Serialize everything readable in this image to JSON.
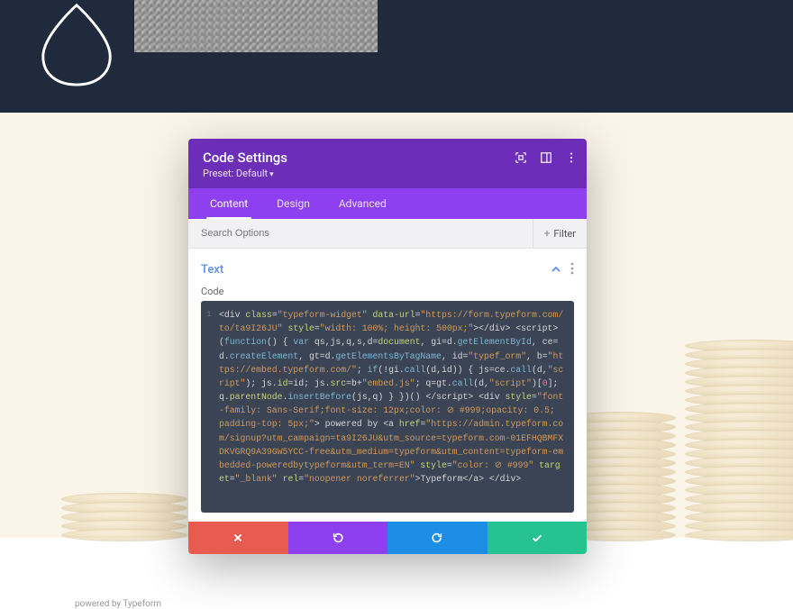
{
  "footer_powered": "powered by Typeform",
  "modal": {
    "title": "Code Settings",
    "preset_label": "Preset: Default",
    "tabs": [
      "Content",
      "Design",
      "Advanced"
    ],
    "active_tab": 0,
    "search_placeholder": "Search Options",
    "filter_label": "Filter",
    "section_title": "Text",
    "field_label": "Code",
    "code_tokens": [
      {
        "t": "tag",
        "v": "<div "
      },
      {
        "t": "attr",
        "v": "class"
      },
      {
        "t": "tag",
        "v": "="
      },
      {
        "t": "str",
        "v": "\"typeform-widget\""
      },
      {
        "t": "tag",
        "v": " "
      },
      {
        "t": "attr",
        "v": "data-url"
      },
      {
        "t": "tag",
        "v": "="
      },
      {
        "t": "str",
        "v": "\"https://form.typeform.com/to/ta9I26JU\""
      },
      {
        "t": "tag",
        "v": " "
      },
      {
        "t": "attr",
        "v": "style"
      },
      {
        "t": "tag",
        "v": "="
      },
      {
        "t": "str",
        "v": "\"width: 100%; height: 500px;\""
      },
      {
        "t": "tag",
        "v": "></div> <script> "
      },
      {
        "t": "key",
        "v": "("
      },
      {
        "t": "fn",
        "v": "function"
      },
      {
        "t": "key",
        "v": "() { "
      },
      {
        "t": "fn",
        "v": "var"
      },
      {
        "t": "key",
        "v": " qs,js,q,s,d="
      },
      {
        "t": "builtin",
        "v": "document"
      },
      {
        "t": "key",
        "v": ", gi=d."
      },
      {
        "t": "fn",
        "v": "getElementById"
      },
      {
        "t": "key",
        "v": ", ce=d."
      },
      {
        "t": "fn",
        "v": "createElement"
      },
      {
        "t": "key",
        "v": ", gt=d."
      },
      {
        "t": "fn",
        "v": "getElementsByTagName"
      },
      {
        "t": "key",
        "v": ", id="
      },
      {
        "t": "str",
        "v": "\"typef_orm\""
      },
      {
        "t": "key",
        "v": ", b="
      },
      {
        "t": "str",
        "v": "\"https://embed.typeform.com/\""
      },
      {
        "t": "key",
        "v": "; "
      },
      {
        "t": "fn",
        "v": "if"
      },
      {
        "t": "key",
        "v": "(!gi."
      },
      {
        "t": "fn",
        "v": "call"
      },
      {
        "t": "key",
        "v": "(d,id)) { js=ce."
      },
      {
        "t": "fn",
        "v": "call"
      },
      {
        "t": "key",
        "v": "(d,"
      },
      {
        "t": "str",
        "v": "\"script\""
      },
      {
        "t": "key",
        "v": "); js."
      },
      {
        "t": "builtin",
        "v": "id"
      },
      {
        "t": "key",
        "v": "=id; js."
      },
      {
        "t": "builtin",
        "v": "src"
      },
      {
        "t": "key",
        "v": "=b+"
      },
      {
        "t": "str",
        "v": "\"embed.js\""
      },
      {
        "t": "key",
        "v": "; q=gt."
      },
      {
        "t": "fn",
        "v": "call"
      },
      {
        "t": "key",
        "v": "(d,"
      },
      {
        "t": "str",
        "v": "\"script\""
      },
      {
        "t": "key",
        "v": ")["
      },
      {
        "t": "pink",
        "v": "0"
      },
      {
        "t": "key",
        "v": "]; q."
      },
      {
        "t": "builtin",
        "v": "parentNode"
      },
      {
        "t": "key",
        "v": "."
      },
      {
        "t": "fn",
        "v": "insertBefore"
      },
      {
        "t": "key",
        "v": "(js,q) } })() "
      },
      {
        "t": "tag",
        "v": "</script> <div "
      },
      {
        "t": "attr",
        "v": "style"
      },
      {
        "t": "tag",
        "v": "="
      },
      {
        "t": "str",
        "v": "\"font-family: Sans-Serif;font-size: 12px;color: ⊘ #999;opacity: 0.5; padding-top: 5px;\""
      },
      {
        "t": "tag",
        "v": "> "
      },
      {
        "t": "key",
        "v": "powered by "
      },
      {
        "t": "tag",
        "v": "<a "
      },
      {
        "t": "attr",
        "v": "href"
      },
      {
        "t": "tag",
        "v": "="
      },
      {
        "t": "str",
        "v": "\"https://admin.typeform.com/signup?utm_campaign=ta9I26JU&utm_source=typeform.com-01EFHQBMFXDKVGRQ9A39GW5YCC-free&utm_medium=typeform&utm_content=typeform-embedded-poweredbytypeform&utm_term=EN\""
      },
      {
        "t": "tag",
        "v": " "
      },
      {
        "t": "attr",
        "v": "style"
      },
      {
        "t": "tag",
        "v": "="
      },
      {
        "t": "str",
        "v": "\"color: ⊘ #999\""
      },
      {
        "t": "tag",
        "v": " "
      },
      {
        "t": "attr",
        "v": "target"
      },
      {
        "t": "tag",
        "v": "="
      },
      {
        "t": "str",
        "v": "\"_blank\""
      },
      {
        "t": "tag",
        "v": " "
      },
      {
        "t": "attr",
        "v": "rel"
      },
      {
        "t": "tag",
        "v": "="
      },
      {
        "t": "str",
        "v": "\"noopener noreferrer\""
      },
      {
        "t": "tag",
        "v": ">"
      },
      {
        "t": "key",
        "v": "Typeform"
      },
      {
        "t": "tag",
        "v": "</a> </div>"
      }
    ]
  }
}
